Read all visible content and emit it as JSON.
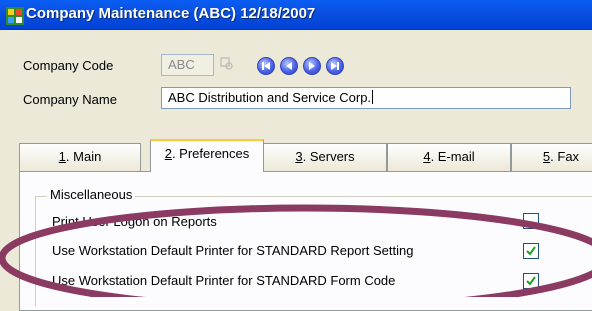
{
  "window": {
    "title": "Company Maintenance (ABC) 12/18/2007",
    "icon": "app-grid-icon"
  },
  "form": {
    "company_code_label": "Company Code",
    "company_code_value": "ABC",
    "company_name_label": "Company Name",
    "company_name_value": "ABC Distribution and Service Corp."
  },
  "nav_buttons": [
    "first-record-icon",
    "previous-record-icon",
    "next-record-icon",
    "last-record-icon"
  ],
  "tabs": [
    {
      "key": "1",
      "rest": ". Main",
      "active": false
    },
    {
      "key": "2",
      "rest": ". Preferences",
      "active": true
    },
    {
      "key": "3",
      "rest": ". Servers",
      "active": false
    },
    {
      "key": "4",
      "rest": ". E-mail",
      "active": false
    },
    {
      "key": "5",
      "rest": ". Fax",
      "active": false
    }
  ],
  "misc_group": {
    "title": "Miscellaneous",
    "rows": [
      {
        "label": "Print User Logon on Reports",
        "checked": false
      },
      {
        "label": "Use Workstation Default Printer for STANDARD Report Setting",
        "checked": true
      },
      {
        "label": "Use Workstation Default Printer for STANDARD Form Code",
        "checked": true
      }
    ]
  },
  "annotation": {
    "color": "#8b3a62"
  }
}
